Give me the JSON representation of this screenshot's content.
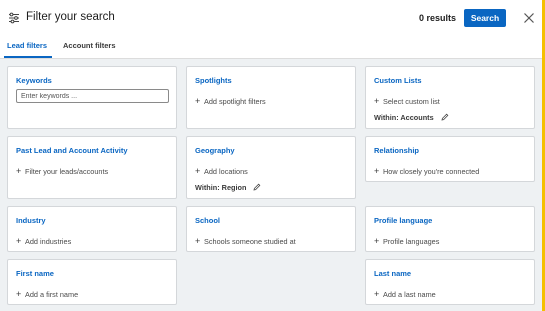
{
  "header": {
    "title": "Filter your search",
    "results": "0 results",
    "search_label": "Search"
  },
  "tabs": [
    {
      "label": "Lead filters",
      "active": true
    },
    {
      "label": "Account filters",
      "active": false
    }
  ],
  "filters": {
    "keywords": {
      "title": "Keywords",
      "placeholder": "Enter keywords ..."
    },
    "spotlights": {
      "title": "Spotlights",
      "action": "Add spotlight filters"
    },
    "custom_lists": {
      "title": "Custom Lists",
      "action": "Select custom list",
      "within": "Within: Accounts"
    },
    "past_activity": {
      "title": "Past Lead and Account Activity",
      "action": "Filter your leads/accounts"
    },
    "geography": {
      "title": "Geography",
      "action": "Add locations",
      "within": "Within: Region"
    },
    "relationship": {
      "title": "Relationship",
      "action": "How closely you're connected"
    },
    "industry": {
      "title": "Industry",
      "action": "Add industries"
    },
    "school": {
      "title": "School",
      "action": "Schools someone studied at"
    },
    "profile_language": {
      "title": "Profile language",
      "action": "Profile languages"
    },
    "first_name": {
      "title": "First name",
      "action": "Add a first name"
    },
    "last_name": {
      "title": "Last name",
      "action": "Add a last name"
    }
  },
  "colors": {
    "accent": "#0a66c2",
    "background": "#eef1f3",
    "card_border": "#d4d7da"
  },
  "icons": {
    "filter": "sliders-icon",
    "close": "close-icon",
    "plus": "plus-icon",
    "edit": "pencil-icon"
  }
}
